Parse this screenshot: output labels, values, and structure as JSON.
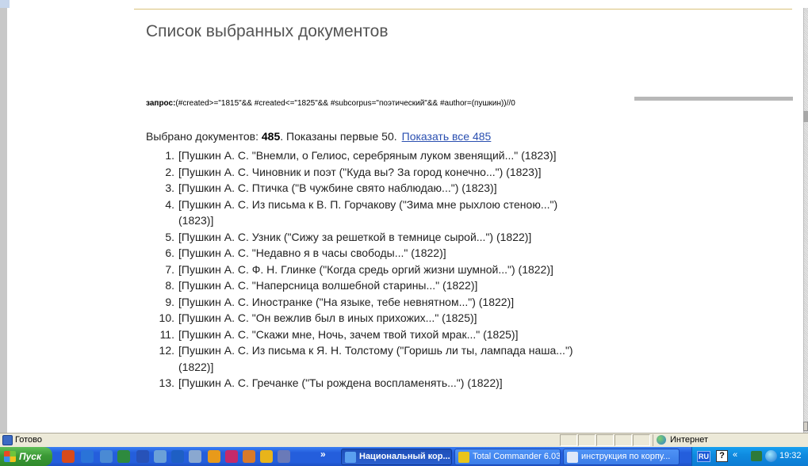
{
  "page": {
    "title": "Список выбранных документов",
    "query_label": "запрос:",
    "query_text": "(#created>=\"1815\"&& #created<=\"1825\"&& #subcorpus=\"поэтический\"&& #author=(пушкин))//0",
    "summary_prefix": "Выбрано документов: ",
    "summary_count": "485",
    "summary_suffix": ".  Показаны первые 50.",
    "show_all_link": "Показать все 485",
    "documents": [
      {
        "num": "1.",
        "text": "[Пушкин А. С. \"Внемли, о Гелиос, серебряным луком звенящий...\" (1823)]"
      },
      {
        "num": "2.",
        "text": "[Пушкин А. С. Чиновник и поэт (\"Куда вы? За город конечно...\") (1823)]"
      },
      {
        "num": "3.",
        "text": "[Пушкин А. С. Птичка (\"В чужбине свято наблюдаю...\") (1823)]"
      },
      {
        "num": "4.",
        "text": "[Пушкин А. С. Из письма к В. П. Горчакову (\"Зима мне рыхлою стеною...\")"
      },
      {
        "num": "",
        "text": "(1823)]"
      },
      {
        "num": "5.",
        "text": "[Пушкин А. С. Узник (\"Сижу за решеткой в темнице сырой...\") (1822)]"
      },
      {
        "num": "6.",
        "text": "[Пушкин А. С. \"Недавно я в часы свободы...\" (1822)]"
      },
      {
        "num": "7.",
        "text": "[Пушкин А. С. Ф. Н. Глинке (\"Когда средь оргий жизни шумной...\") (1822)]"
      },
      {
        "num": "8.",
        "text": "[Пушкин А. С. \"Наперсница волшебной старины...\" (1822)]"
      },
      {
        "num": "9.",
        "text": "[Пушкин А. С. Иностранке (\"На языке, тебе невнятном...\") (1822)]"
      },
      {
        "num": "10.",
        "text": "[Пушкин А. С. \"Он вежлив был в иных прихожих...\" (1825)]"
      },
      {
        "num": "11.",
        "text": "[Пушкин А. С. \"Скажи мне, Ночь, зачем твой тихой мрак...\" (1825)]"
      },
      {
        "num": "12.",
        "text": "[Пушкин А. С. Из письма к Я. Н. Толстому (\"Горишь ли ты, лампада наша...\")"
      },
      {
        "num": "",
        "text": "(1822)]"
      },
      {
        "num": "13.",
        "text": "[Пушкин А. С. Гречанке (\"Ты рождена воспламенять...\") (1822)]"
      }
    ]
  },
  "status_bar": {
    "status_text": "Готово",
    "zone_text": "Интернет"
  },
  "taskbar": {
    "start_label": "Пуск",
    "more_label": "»",
    "tasks": [
      {
        "label": "Национальный кор...",
        "active": true
      },
      {
        "label": "Total Commander 6.03...",
        "active": false
      },
      {
        "label": "инструкция по корпу...",
        "active": false
      }
    ],
    "lang": "RU",
    "help": "?",
    "tray_expand": "«",
    "clock": "19:32"
  },
  "colors": {
    "title": "#545454",
    "link": "#2a4fb0",
    "taskbar": "#245edc",
    "start": "#3c9a36"
  }
}
